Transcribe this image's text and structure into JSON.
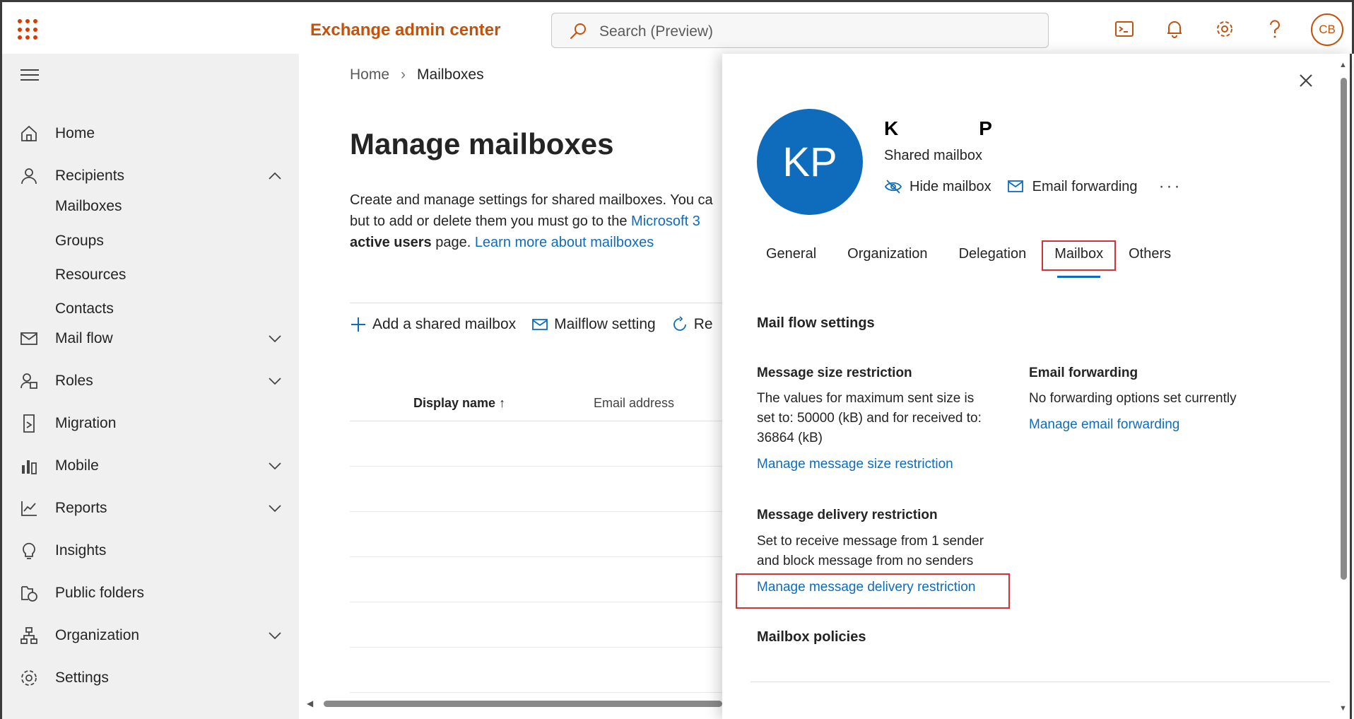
{
  "app": {
    "title": "Exchange admin center"
  },
  "search": {
    "placeholder": "Search (Preview)"
  },
  "user": {
    "initials": "CB"
  },
  "sidebar": {
    "items": [
      {
        "label": "Home"
      },
      {
        "label": "Recipients"
      },
      {
        "label": "Mail flow"
      },
      {
        "label": "Roles"
      },
      {
        "label": "Migration"
      },
      {
        "label": "Mobile"
      },
      {
        "label": "Reports"
      },
      {
        "label": "Insights"
      },
      {
        "label": "Public folders"
      },
      {
        "label": "Organization"
      },
      {
        "label": "Settings"
      }
    ],
    "sub_items": [
      {
        "label": "Mailboxes"
      },
      {
        "label": "Groups"
      },
      {
        "label": "Resources"
      },
      {
        "label": "Contacts"
      }
    ]
  },
  "main": {
    "breadcrumb": {
      "home": "Home",
      "current": "Mailboxes"
    },
    "title": "Manage mailboxes",
    "description": {
      "line1": "Create and manage settings for shared mailboxes. You ca",
      "line2_text": "but to add or delete them you must go to the ",
      "line2_link": "Microsoft 3",
      "line3_bold": "active users",
      "line3_text": " page. ",
      "line3_link": "Learn more about mailboxes"
    },
    "toolbar": {
      "add_label": "Add a shared mailbox",
      "mailflow_label": "Mailflow setting",
      "refresh_label": "Re"
    },
    "grid": {
      "col_name": "Display name",
      "col_email": "Email address"
    }
  },
  "panel": {
    "avatar_initials": "KP",
    "name_first": "K",
    "name_last": "P",
    "mailbox_type": "Shared mailbox",
    "actions": {
      "hide": "Hide mailbox",
      "forwarding": "Email forwarding",
      "more": "···"
    },
    "tabs": [
      {
        "label": "General"
      },
      {
        "label": "Organization"
      },
      {
        "label": "Delegation"
      },
      {
        "label": "Mailbox"
      },
      {
        "label": "Others"
      }
    ],
    "mail_flow": {
      "title": "Mail flow settings",
      "size_title": "Message size restriction",
      "size_text_1": "The values for maximum sent size is",
      "size_text_2": "set to: 50000 (kB) and for received to:",
      "size_text_3": "36864 (kB)",
      "size_link": "Manage message size restriction",
      "fwd_title": "Email forwarding",
      "fwd_text": "No forwarding options set currently",
      "fwd_link": "Manage email forwarding",
      "delivery_title": "Message delivery restriction",
      "delivery_text_1": "Set to receive message from 1 sender",
      "delivery_text_2": "and block message from no senders",
      "delivery_link": "Manage message delivery restriction"
    },
    "policies": {
      "title": "Mailbox policies"
    }
  },
  "colors": {
    "accent": "#c4520c",
    "link": "#0f6cbd",
    "highlight": "#d13438",
    "avatar": "#0f6cbd"
  }
}
